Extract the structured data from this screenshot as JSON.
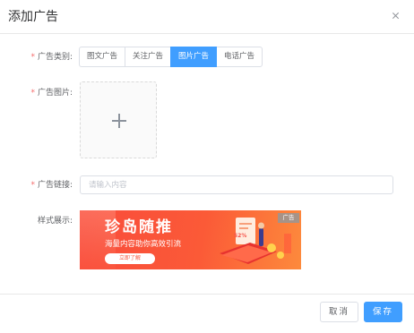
{
  "dialog": {
    "title": "添加广告",
    "close_symbol": "close-icon"
  },
  "form": {
    "type_label": "广告类别:",
    "type_options": [
      "图文广告",
      "关注广告",
      "图片广告",
      "电话广告"
    ],
    "type_selected": "图片广告",
    "image_label": "广告图片:",
    "link_label": "广告链接:",
    "link_value": "",
    "link_placeholder": "请输入内容",
    "preview_label": "样式展示:",
    "required_mark": "*"
  },
  "banner": {
    "title": "珍岛随推",
    "subtitle": "海量内容助你高效引流",
    "button": "立即了解",
    "tag": "广告",
    "badge": "52%",
    "colors": {
      "start": "#f94b3c",
      "end": "#fd8a3c"
    }
  },
  "footer": {
    "cancel_label": "取消",
    "save_label": "保存"
  },
  "colors": {
    "primary": "#409eff",
    "required": "#f56c6c",
    "border": "#dcdfe6"
  }
}
